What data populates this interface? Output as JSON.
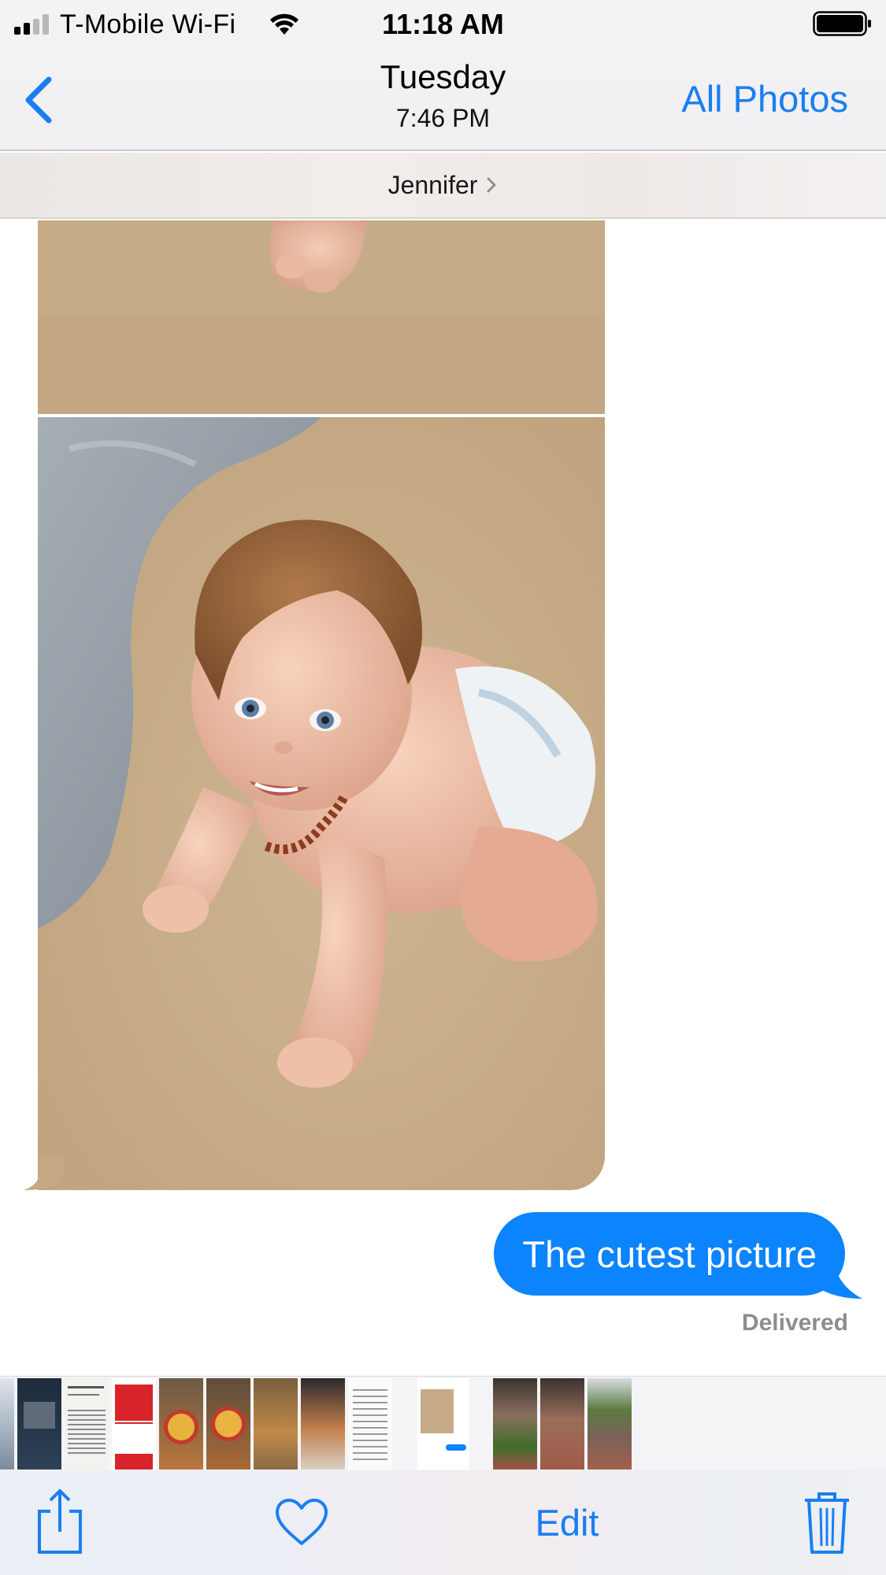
{
  "status_bar": {
    "carrier": "T-Mobile Wi-Fi",
    "time": "11:18 AM",
    "signal_bars_active": 2,
    "signal_bars_total": 4
  },
  "nav": {
    "title": "Tuesday",
    "subtitle": "7:46 PM",
    "right_action": "All Photos",
    "back_icon": "chevron-left-icon"
  },
  "contact": {
    "name": "Jennifer",
    "chevron_icon": "chevron-right-icon"
  },
  "conversation": {
    "photos": [
      {
        "name": "baby-feet-on-carpet-photo"
      },
      {
        "name": "crawling-baby-photo"
      }
    ],
    "sent_message": "The cutest picture",
    "receipt": "Delivered"
  },
  "thumbnail_strip": {
    "count": 14
  },
  "toolbar": {
    "share_icon": "share-icon",
    "favorite_icon": "heart-icon",
    "edit_label": "Edit",
    "delete_icon": "trash-icon"
  },
  "colors": {
    "accent_blue": "#1a7ef2",
    "bubble_blue": "#0b84fe",
    "delivered_gray": "#8d8d91",
    "carpet_tan": "#c8ae8a"
  }
}
